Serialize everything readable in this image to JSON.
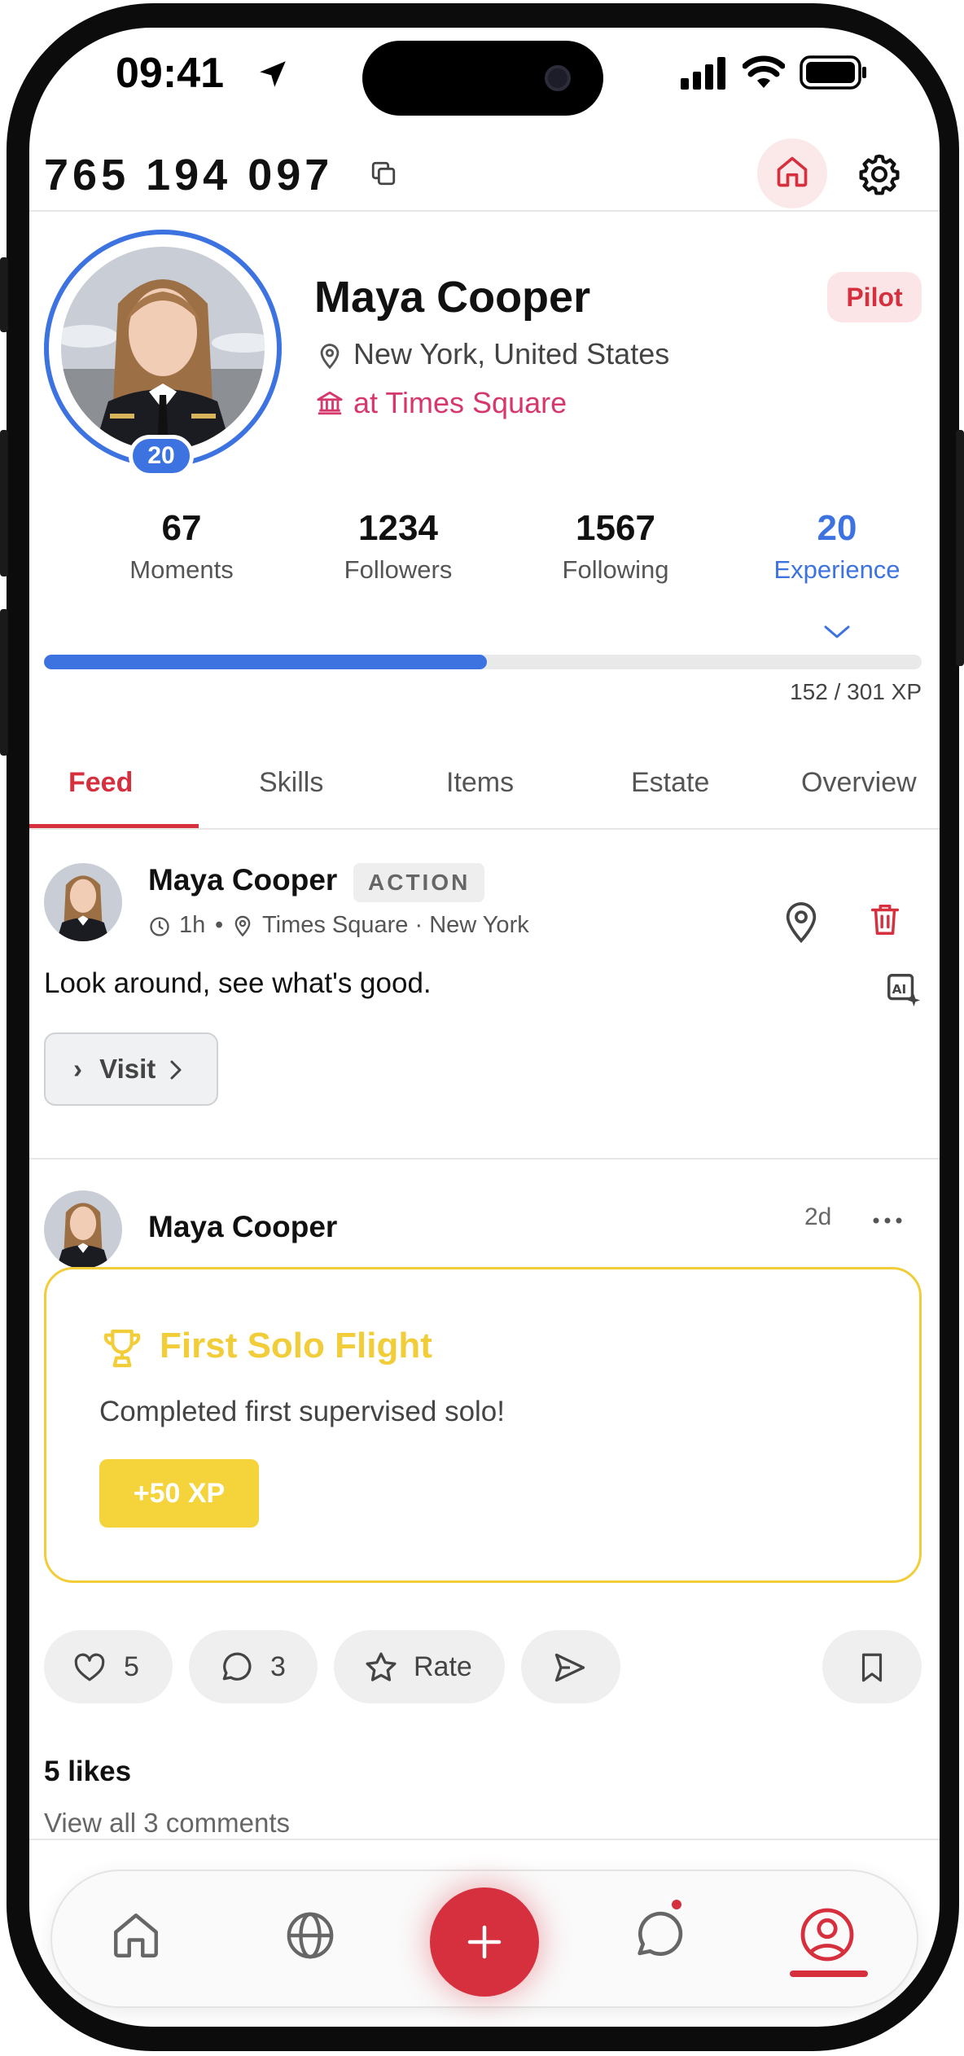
{
  "status_bar": {
    "time": "09:41"
  },
  "header": {
    "account_id": "765 194 097"
  },
  "profile": {
    "name": "Maya Cooper",
    "role": "Pilot",
    "location": "New York, United States",
    "venue": "at Times Square",
    "level": "20",
    "stats": [
      {
        "value": "67",
        "label": "Moments"
      },
      {
        "value": "1234",
        "label": "Followers"
      },
      {
        "value": "1567",
        "label": "Following"
      },
      {
        "value": "20",
        "label": "Experience"
      }
    ],
    "xp_text": "152 / 301 XP",
    "xp_fraction": 0.505
  },
  "tabs": [
    "Feed",
    "Skills",
    "Items",
    "Estate",
    "Overview"
  ],
  "active_tab": "Feed",
  "posts": [
    {
      "author": "Maya Cooper",
      "tag": "ACTION",
      "time": "1h",
      "place": "Times Square · New York",
      "text": "Look around, see what's good.",
      "button": "Visit",
      "button_prefix": "›"
    },
    {
      "author": "Maya Cooper",
      "time_ago": "2d",
      "achievement_title": "First Solo Flight",
      "achievement_desc": "Completed first supervised solo!",
      "achievement_xp": "+50 XP",
      "like_count": "5",
      "comment_count": "3",
      "rate_label": "Rate",
      "likes_text": "5 likes",
      "view_comments": "View all 3 comments"
    }
  ],
  "colors": {
    "accent_blue": "#3d73e0",
    "brand_red": "#d6303f",
    "gold": "#f2cd3a"
  },
  "icons": [
    "location-arrow-icon",
    "signal-icon",
    "wifi-icon",
    "battery-icon",
    "copy-icon",
    "home-icon",
    "gear-icon",
    "pin-icon",
    "bank-icon",
    "chevron-down-icon",
    "clock-icon",
    "map-pin-icon",
    "trash-icon",
    "ai-image-icon",
    "chevron-right-icon",
    "more-icon",
    "trophy-icon",
    "heart-icon",
    "comment-icon",
    "star-icon",
    "send-icon",
    "bookmark-icon",
    "globe-icon",
    "plus-icon",
    "chat-icon",
    "user-icon"
  ]
}
